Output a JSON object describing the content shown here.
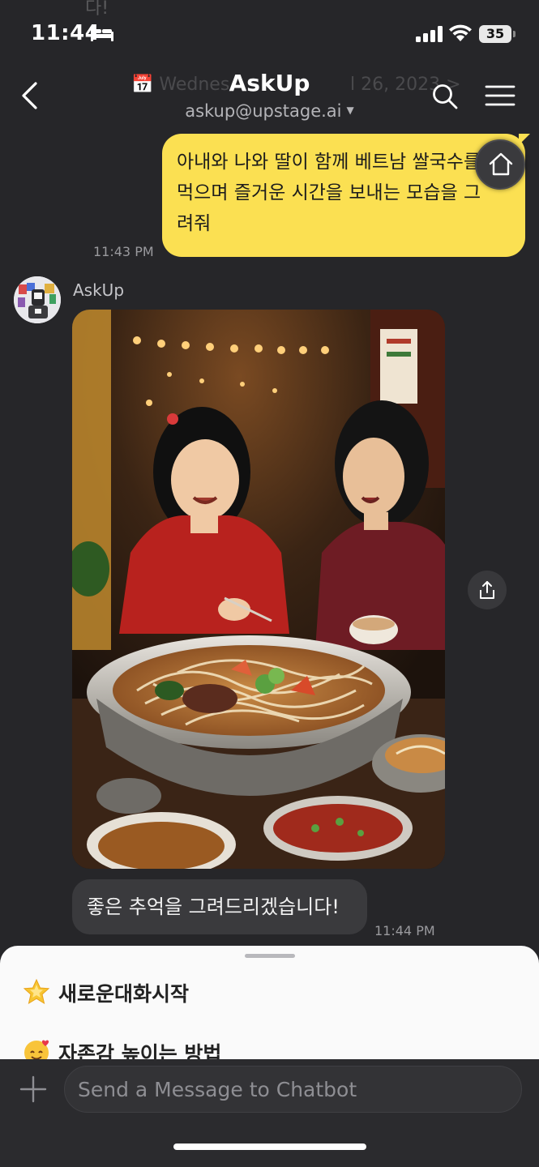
{
  "status_bar": {
    "time": "11:44",
    "battery": "35"
  },
  "background_ghost": {
    "top_text": "다!",
    "date_left": "📅 Wednes",
    "date_right": "l 26, 2023 >"
  },
  "header": {
    "title": "AskUp",
    "subtitle": "askup@upstage.ai"
  },
  "messages": {
    "user_text": "아내와 나와 딸이 함께 베트남 쌀국수를 먹으며 즐거운 시간을 보내는 모습을 그려줘",
    "user_time": "11:43 PM",
    "bot_name": "AskUp",
    "bot_reply": "좋은 추억을 그려드리겠습니다!",
    "bot_time": "11:44 PM"
  },
  "sheet": {
    "items": [
      {
        "icon": "star-icon",
        "label": "새로운대화시작"
      },
      {
        "icon": "smiling-face-with-hearts-icon",
        "label": "자존감 높이는 방법"
      }
    ]
  },
  "input": {
    "placeholder": "Send a Message to Chatbot"
  },
  "colors": {
    "background": "#262629",
    "user_bubble": "#fbe052",
    "bot_bubble": "#3a3a3d",
    "sheet": "#fafafa"
  }
}
